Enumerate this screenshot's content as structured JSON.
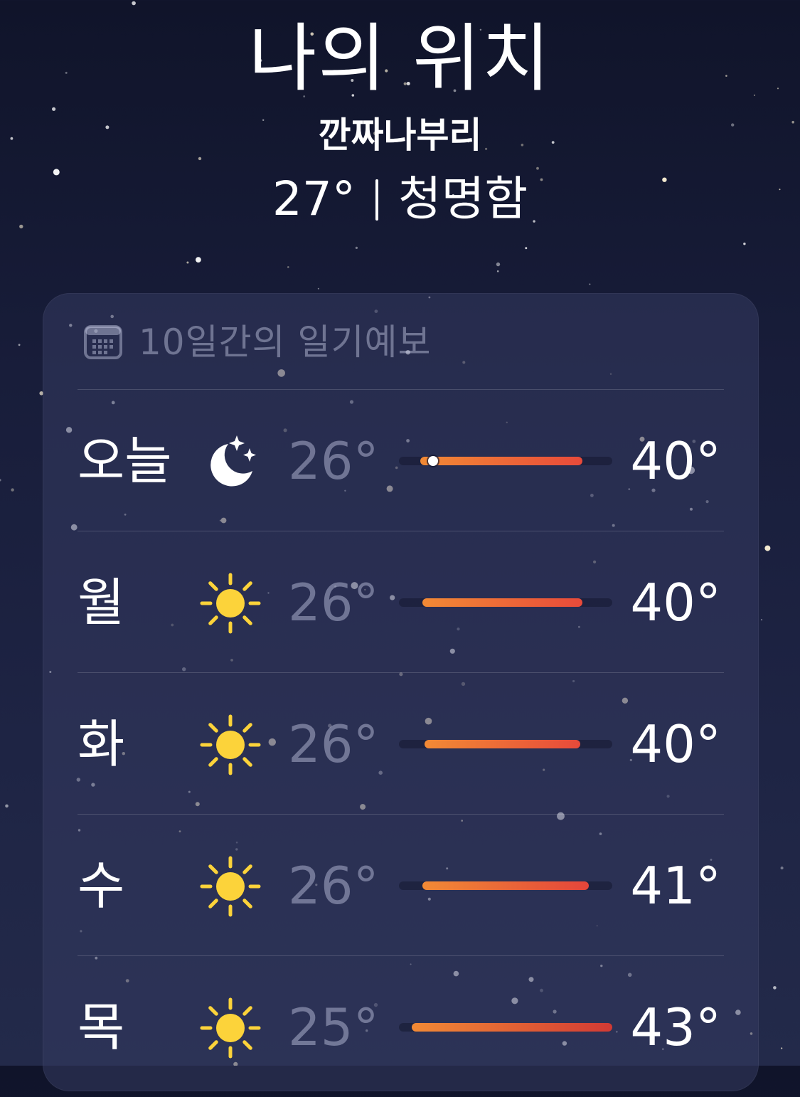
{
  "header": {
    "title": "나의 위치",
    "subtitle": "깐짜나부리",
    "temperature": "27°",
    "condition": "청명함"
  },
  "forecast": {
    "title": "10일간의 일기예보",
    "icon": "calendar-icon",
    "rows": [
      {
        "day": "오늘",
        "icon": "moon-stars-icon",
        "low": "26°",
        "high": "40°",
        "range_start": 0.1,
        "range_end": 0.86,
        "current": 0.16,
        "tail_color": "#e84a3a"
      },
      {
        "day": "월",
        "icon": "sun-icon",
        "low": "26°",
        "high": "40°",
        "range_start": 0.11,
        "range_end": 0.86,
        "tail_color": "#e84a3a"
      },
      {
        "day": "화",
        "icon": "sun-icon",
        "low": "26°",
        "high": "40°",
        "range_start": 0.12,
        "range_end": 0.85,
        "tail_color": "#e84a3a"
      },
      {
        "day": "수",
        "icon": "sun-icon",
        "low": "26°",
        "high": "41°",
        "range_start": 0.11,
        "range_end": 0.89,
        "tail_color": "#e4453a"
      },
      {
        "day": "목",
        "icon": "sun-icon",
        "low": "25°",
        "high": "43°",
        "range_start": 0.06,
        "range_end": 1.0,
        "tail_color": "#d23a34"
      }
    ]
  },
  "colors": {
    "sun": "#fcd33a",
    "moon": "#ffffff",
    "bar_start": "#f28a35",
    "bar_end": "#e2433a"
  }
}
